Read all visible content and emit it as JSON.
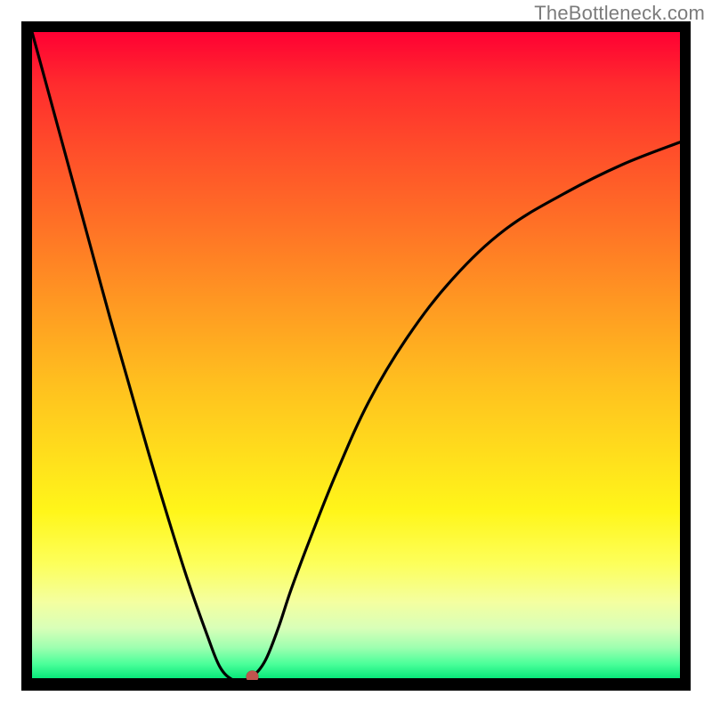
{
  "domain": "Chart",
  "watermark": "TheBottleneck.com",
  "chart_data": {
    "type": "line",
    "title": "",
    "xlabel": "",
    "ylabel": "",
    "xlim": [
      0,
      100
    ],
    "ylim": [
      0,
      100
    ],
    "x": [
      0,
      3,
      6,
      9,
      12,
      15,
      18,
      21,
      24,
      27,
      29,
      31,
      32.5,
      34,
      36,
      38,
      40,
      43,
      47,
      52,
      58,
      65,
      73,
      82,
      91,
      100
    ],
    "values": [
      100,
      89,
      78,
      67,
      56,
      45.5,
      35,
      25,
      15.5,
      7,
      2,
      0,
      0,
      0.5,
      3,
      8,
      14,
      22,
      32,
      43,
      53,
      62,
      69.5,
      75,
      79.5,
      83
    ],
    "marker": {
      "x": 34,
      "y": 0.5,
      "color": "#c0544e"
    },
    "gradient_stops": [
      {
        "pct": 0,
        "color": "#ff0033"
      },
      {
        "pct": 18,
        "color": "#ff4d2a"
      },
      {
        "pct": 42,
        "color": "#ff9922"
      },
      {
        "pct": 66,
        "color": "#ffe01c"
      },
      {
        "pct": 82,
        "color": "#fdff5a"
      },
      {
        "pct": 92,
        "color": "#d8ffb8"
      },
      {
        "pct": 100,
        "color": "#00e676"
      }
    ]
  }
}
